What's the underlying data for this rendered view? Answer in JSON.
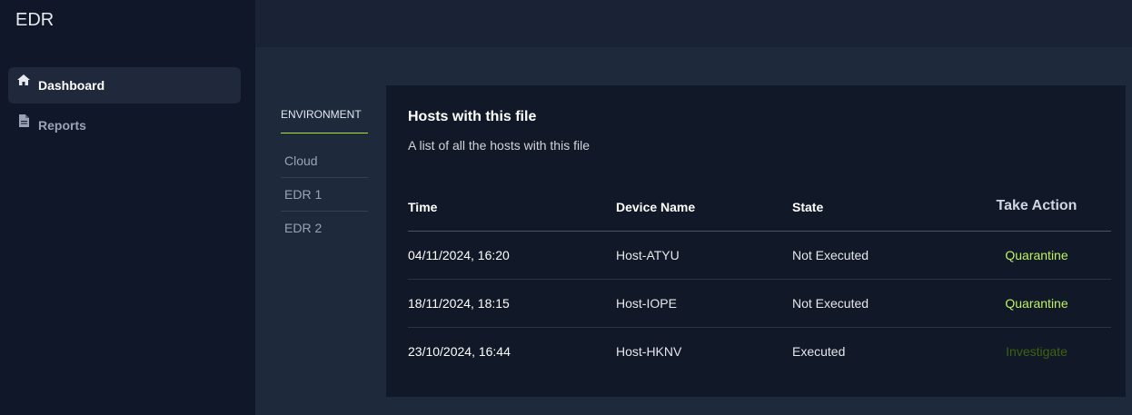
{
  "app": {
    "title": "EDR"
  },
  "sidebar": {
    "items": [
      {
        "label": "Dashboard",
        "icon": "home-icon",
        "active": true
      },
      {
        "label": "Reports",
        "icon": "file-icon",
        "active": false
      }
    ]
  },
  "environment": {
    "header": "ENVIRONMENT",
    "items": [
      "Cloud",
      "EDR 1",
      "EDR 2"
    ]
  },
  "hosts_card": {
    "title": "Hosts with this file",
    "subtitle": "A list of all the hosts with this file",
    "columns": {
      "time": "Time",
      "device": "Device Name",
      "state": "State",
      "action": "Take Action"
    },
    "rows": [
      {
        "time": "04/11/2024, 16:20",
        "device": "Host-ATYU",
        "state": "Not Executed",
        "action": "Quarantine"
      },
      {
        "time": "18/11/2024, 18:15",
        "device": "Host-IOPE",
        "state": "Not Executed",
        "action": "Quarantine"
      },
      {
        "time": "23/10/2024, 16:44",
        "device": "Host-HKNV",
        "state": "Executed",
        "action": "Investigate"
      }
    ]
  },
  "colors": {
    "accent": "#a3e635",
    "quarantine": "#bef264",
    "investigate": "#3f6212"
  }
}
